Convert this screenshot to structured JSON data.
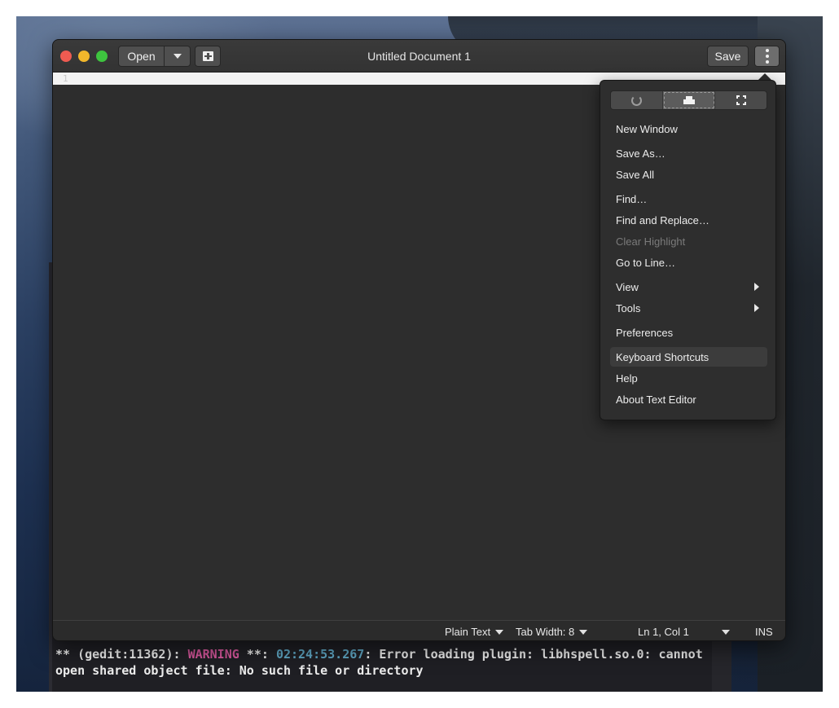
{
  "window": {
    "title": "Untitled Document 1",
    "open_label": "Open",
    "save_label": "Save"
  },
  "editor": {
    "line_number": "1"
  },
  "statusbar": {
    "language": "Plain Text",
    "tab_width": "Tab Width: 8",
    "position": "Ln 1, Col 1",
    "mode": "INS"
  },
  "menu": {
    "toolbar_icons": [
      "refresh-icon",
      "print-icon",
      "fullscreen-icon"
    ],
    "items": [
      {
        "label": "New Window"
      },
      {
        "label": "Save As…"
      },
      {
        "label": "Save All"
      },
      {
        "label": "Find…"
      },
      {
        "label": "Find and Replace…"
      },
      {
        "label": "Clear Highlight",
        "disabled": true
      },
      {
        "label": "Go to Line…"
      },
      {
        "label": "View",
        "submenu": true
      },
      {
        "label": "Tools",
        "submenu": true
      },
      {
        "label": "Preferences"
      },
      {
        "label": "Keyboard Shortcuts",
        "highlighted": true
      },
      {
        "label": "Help"
      },
      {
        "label": "About Text Editor"
      }
    ]
  },
  "terminal": {
    "prefix": "** (gedit:11362): ",
    "level": "WARNING",
    "mid": " **: ",
    "time": "02:24:53.267",
    "message": ": Error loading plugin: libhspell.so.0: cannot open shared object file: No such file or directory"
  },
  "colors": {
    "warning": "#d6579c",
    "timestamp": "#5fa7c5",
    "close": "#ee5b51",
    "minimize": "#f2b72b",
    "maximize": "#3ec43f"
  }
}
